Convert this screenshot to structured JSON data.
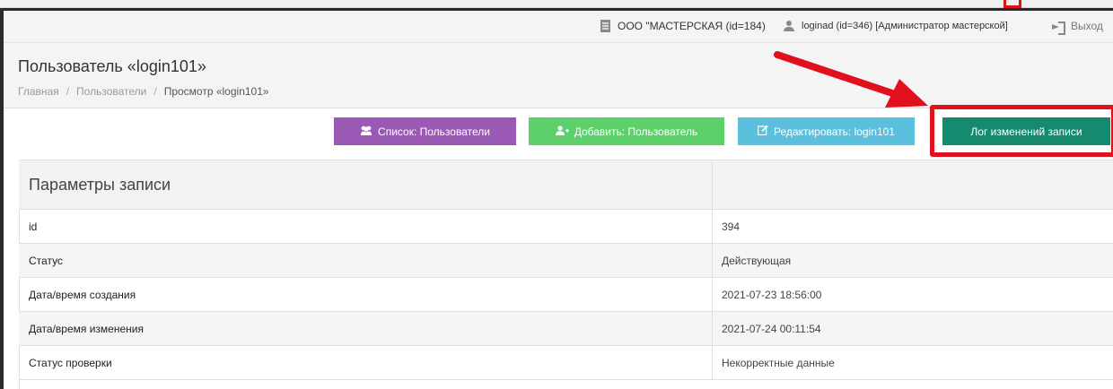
{
  "topbar": {
    "org": "ООО \"МАСТЕРСКАЯ (id=184)",
    "user": "loginad (id=346) [Администратор мастерской]",
    "logout": "Выход"
  },
  "header": {
    "title": "Пользователь «login101»",
    "breadcrumb": {
      "home": "Главная",
      "sep1": "/",
      "users": "Пользователи",
      "sep2": "/",
      "current": "Просмотр «login101»"
    }
  },
  "toolbar": {
    "list_label": "Список: Пользователи",
    "add_label": "Добавить: Пользователь",
    "edit_label": "Редактировать: login101",
    "log_label": "Лог изменений записи"
  },
  "record": {
    "section_title": "Параметры записи",
    "rows": [
      {
        "label": "id",
        "value": "394"
      },
      {
        "label": "Статус",
        "value": "Действующая"
      },
      {
        "label": "Дата/время создания",
        "value": "2021-07-23 18:56:00"
      },
      {
        "label": "Дата/время изменения",
        "value": "2021-07-24 00:11:54"
      },
      {
        "label": "Статус проверки",
        "value": "Некорректные данные"
      }
    ]
  },
  "colors": {
    "list_button": "#9b59b6",
    "add_button": "#5cd16b",
    "edit_button": "#5bc0de",
    "log_button": "#158a6e",
    "annotation": "#e0101c"
  },
  "icons": {
    "org": "building-icon",
    "user": "user-icon",
    "logout": "logout-icon",
    "list": "users-icon",
    "add": "user-plus-icon",
    "edit": "edit-icon"
  }
}
